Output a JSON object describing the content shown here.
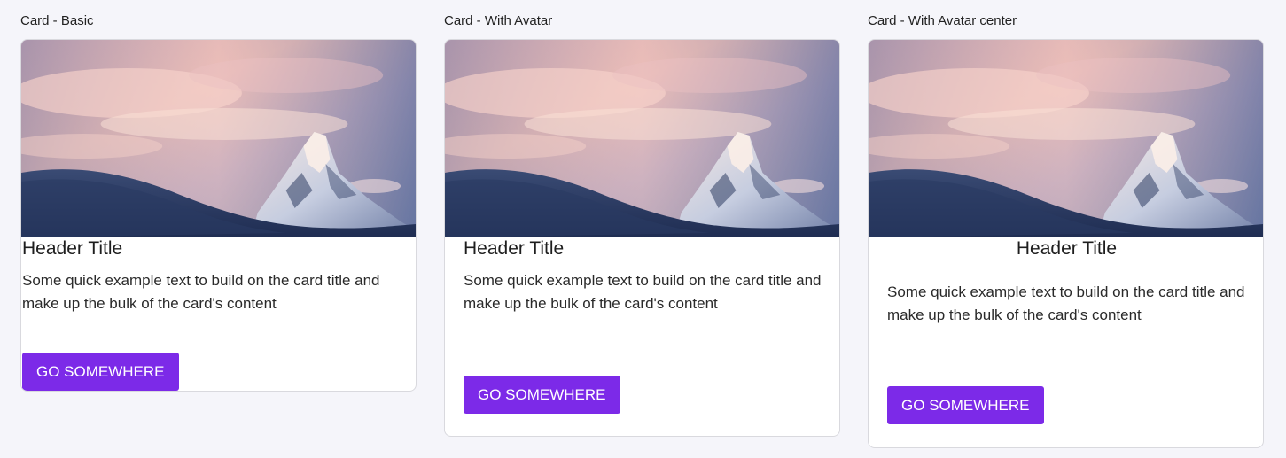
{
  "cards": [
    {
      "label": "Card - Basic",
      "title": "Header Title",
      "text": "Some quick example text to build on the card title and make up the bulk of the card's content",
      "button": "GO SOMEWHERE"
    },
    {
      "label": "Card - With Avatar",
      "title": "Header Title",
      "text": "Some quick example text to build on the card title and make up the bulk of the card's content",
      "button": "GO SOMEWHERE"
    },
    {
      "label": "Card - With Avatar center",
      "title": "Header Title",
      "text": "Some quick example text to build on the card title and make up the bulk of the card's content",
      "button": "GO SOMEWHERE"
    }
  ],
  "colors": {
    "page_background": "#f5f5fa",
    "button_background": "#7c2ae8",
    "button_text": "#ffffff",
    "card_background": "#ffffff"
  },
  "image": {
    "subject": "mountain-peak-at-sunset"
  }
}
